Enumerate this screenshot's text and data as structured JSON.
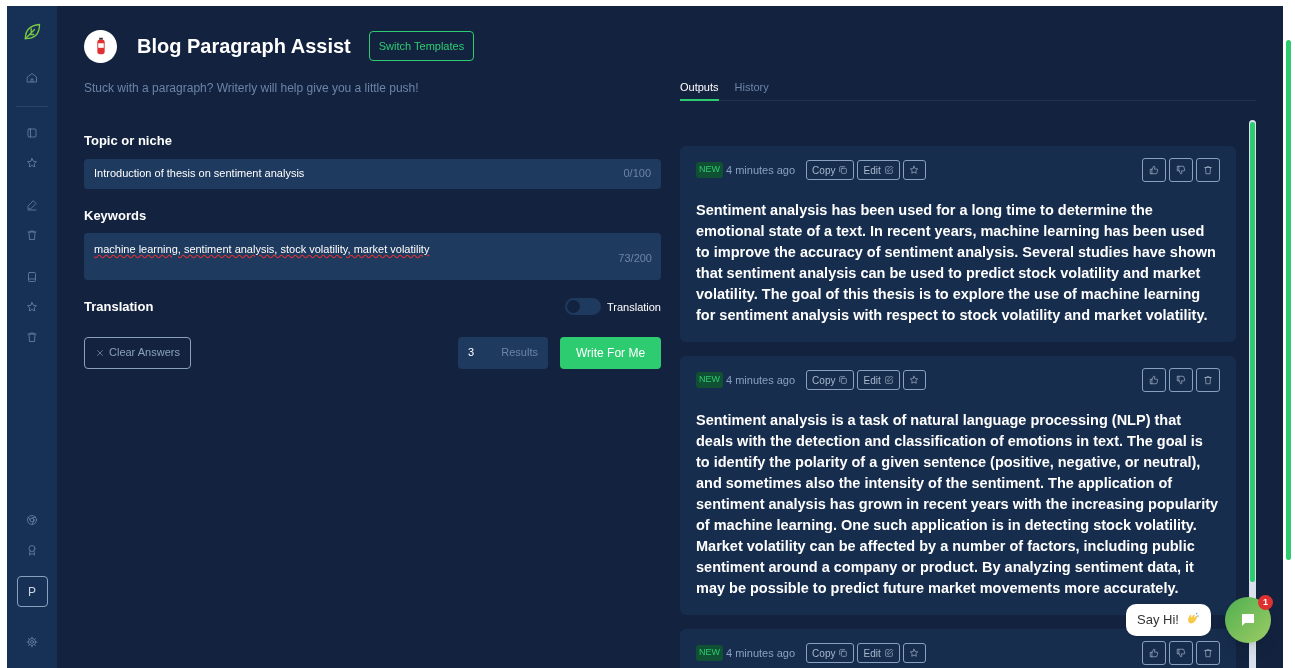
{
  "sidebar": {
    "avatar": "P"
  },
  "header": {
    "title": "Blog Paragraph Assist",
    "switch_button": "Switch Templates",
    "subtitle": "Stuck with a paragraph? Writerly will help give you a little push!"
  },
  "form": {
    "fields": [
      {
        "kind": "input",
        "label": "Topic or niche",
        "value": "Introduction of thesis on sentiment analysis",
        "counter": "0/100"
      },
      {
        "kind": "textarea",
        "label": "Keywords",
        "value": "machine learning, sentiment analysis, stock volatility, market volatility",
        "counter": "73/200"
      }
    ],
    "translation": {
      "label": "Translation",
      "toggle_label": "Translation",
      "on": false
    },
    "clear_button": "Clear Answers",
    "results": {
      "value": "3",
      "label": "Results"
    },
    "submit_button": "Write For Me"
  },
  "tabs": [
    {
      "label": "Outputs",
      "selected": true
    },
    {
      "label": "History",
      "selected": false
    }
  ],
  "outputs": [
    {
      "badge": "NEW",
      "time": "4 minutes ago",
      "copy": "Copy",
      "edit": "Edit",
      "text": "Sentiment analysis has been used for a long time to determine the emotional state of a text. In recent years, machine learning has been used to improve the accuracy of sentiment analysis. Several studies have shown that sentiment analysis can be used to predict stock volatility and market volatility. The goal of this thesis is to explore the use of machine learning for sentiment analysis with respect to stock volatility and market volatility."
    },
    {
      "badge": "NEW",
      "time": "4 minutes ago",
      "copy": "Copy",
      "edit": "Edit",
      "text": "Sentiment analysis is a task of natural language processing (NLP) that deals with the detection and classification of emotions in text. The goal is to identify the polarity of a given sentence (positive, negative, or neutral), and sometimes also the intensity of the sentiment. The application of sentiment analysis has grown in recent years with the increasing popularity of machine learning. One such application is in detecting stock volatility. Market volatility can be affected by a number of factors, including public sentiment around a company or product. By analyzing sentiment data, it may be possible to predict future market movements more accurately."
    },
    {
      "badge": "NEW",
      "time": "4 minutes ago",
      "copy": "Copy",
      "edit": "Edit"
    }
  ],
  "chat": {
    "greeting": "Say Hi!",
    "badge": "1"
  }
}
